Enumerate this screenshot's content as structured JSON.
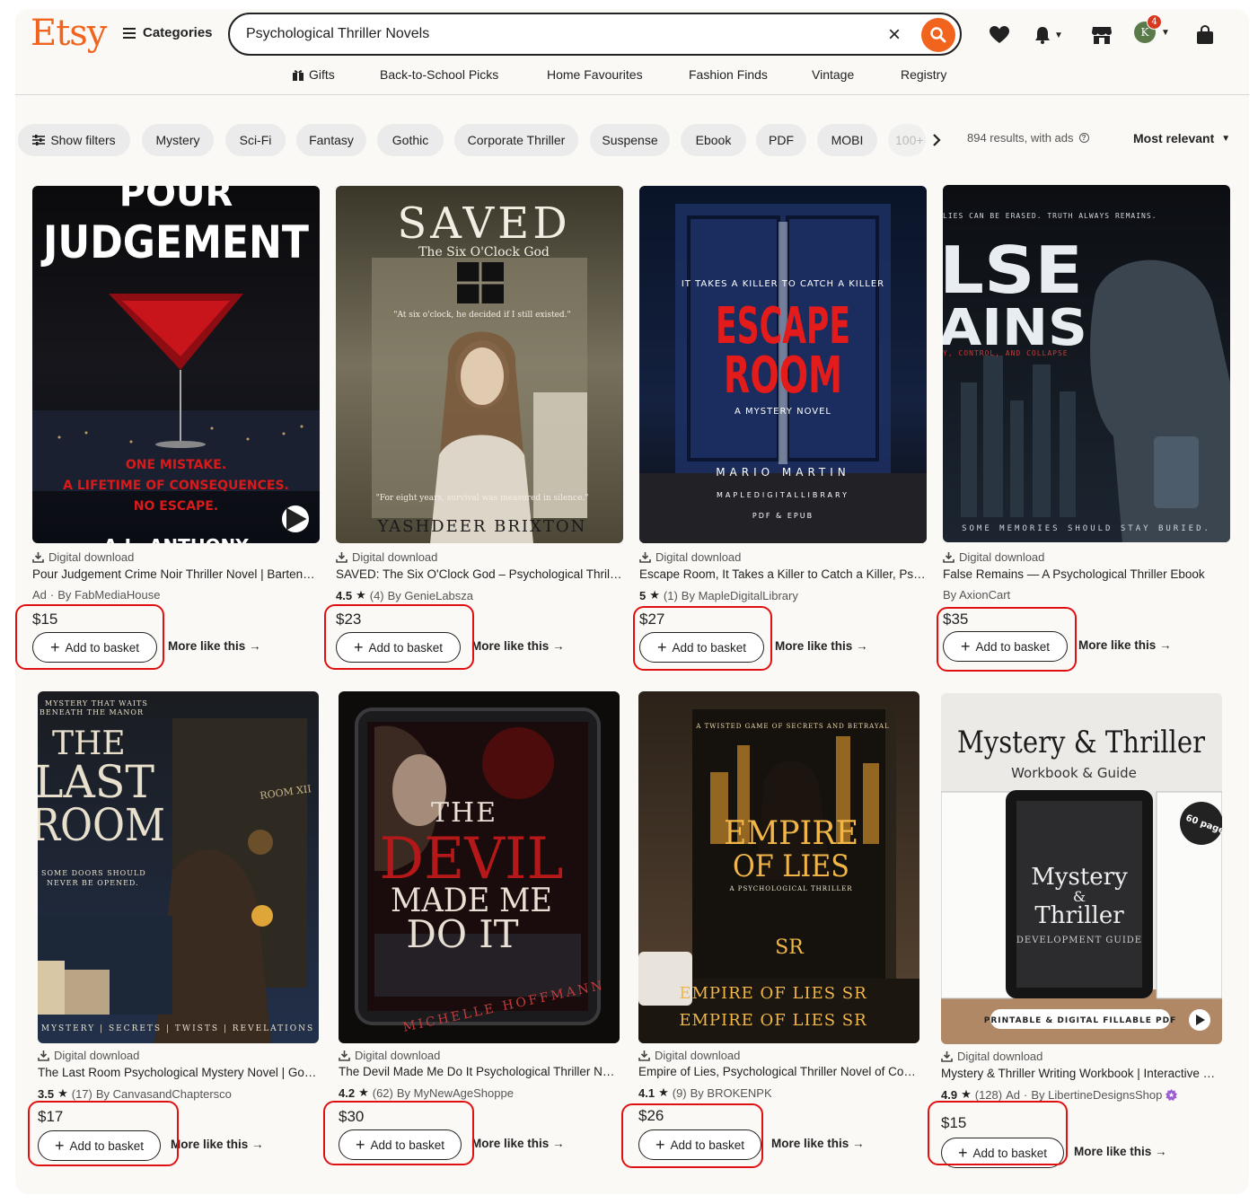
{
  "header": {
    "logo": "Etsy",
    "categories_label": "Categories",
    "search_value": "Psychological Thriller Novels",
    "notifications_count": "4",
    "avatar_letter": "K"
  },
  "nav": [
    "Gifts",
    "Back-to-School Picks",
    "Home Favourites",
    "Fashion Finds",
    "Vintage",
    "Registry"
  ],
  "filters": {
    "show_filters": "Show filters",
    "chips": [
      "Mystery",
      "Sci-Fi",
      "Fantasy",
      "Gothic",
      "Corporate Thriller",
      "Suspense",
      "Ebook",
      "PDF",
      "MOBI",
      "100+"
    ],
    "results": "894 results, with ads",
    "sort": "Most relevant"
  },
  "common": {
    "digital_download": "Digital download",
    "add_to_basket": "Add to basket",
    "more_like_this": "More like this →"
  },
  "listings": [
    {
      "title": "Pour Judgement Crime Noir Thriller Novel | Bartender Thriller",
      "rating": "",
      "reviews": "",
      "ad": "Ad",
      "shop": "By FabMediaHouse",
      "price": "$15",
      "cover_top": "POUR",
      "cover_main": "JUDGEMENT",
      "cover_tag": "ONE MISTAKE. A LIFETIME OF CONSEQUENCES. NO ESCAPE.",
      "cover_author": "A.L. ANTHONY"
    },
    {
      "title": "SAVED: The Six O'Clock God – Psychological Thriller Ebook",
      "rating": "4.5",
      "reviews": "(4)",
      "ad": "",
      "shop": "By GenieLabsza",
      "price": "$23",
      "cover_main": "SAVED",
      "cover_sub": "The Six O'Clock God",
      "cover_quote": "\"At six o'clock, he decided if I still existed.\"",
      "cover_quote2": "\"For eight years, survival was measured in silence.\"",
      "cover_author": "YASHDEER BRIXTON"
    },
    {
      "title": "Escape Room, It Takes a Killer to Catch a Killer, Psychological Thriller",
      "rating": "5",
      "reviews": "(1)",
      "ad": "",
      "shop": "By MapleDigitalLibrary",
      "price": "$27",
      "cover_top": "IT TAKES A KILLER TO CATCH A KILLER",
      "cover_main1": "ESCAPE",
      "cover_main2": "ROOM",
      "cover_sub": "A MYSTERY NOVEL",
      "cover_author": "MARIO MARTIN",
      "cover_pub": "MAPLEDIGITALLIBRARY",
      "cover_fmt": "PDF & EPUB"
    },
    {
      "title": "False Remains — A Psychological Thriller Ebook",
      "rating": "",
      "reviews": "",
      "ad": "",
      "shop": "By AxionCart",
      "price": "$35",
      "cover_top": "LIES CAN BE ERASED. TRUTH ALWAYS REMAINS.",
      "cover_main1": "LSE",
      "cover_main2": "AINS",
      "cover_sub": "Y, CONTROL, AND COLLAPSE",
      "cover_bottom": "SOME MEMORIES SHOULD STAY BURIED."
    },
    {
      "title": "The Last Room Psychological Mystery Novel | Gothic Thriller",
      "rating": "3.5",
      "reviews": "(17)",
      "ad": "",
      "shop": "By CanvasandChaptersco",
      "price": "$17",
      "cover_top": "MYSTERY THAT WAITS BENEATH THE MANOR",
      "cover_main1": "THE",
      "cover_main2": "LAST",
      "cover_main3": "ROOM",
      "cover_sub": "SOME DOORS SHOULD NEVER BE OPENED.",
      "cover_door": "ROOM XII",
      "cover_bottom": "MYSTERY | SECRETS | TWISTS | REVELATIONS"
    },
    {
      "title": "The Devil Made Me Do It Psychological Thriller Novel Ebook",
      "rating": "4.2",
      "reviews": "(62)",
      "ad": "",
      "shop": "By MyNewAgeShoppe",
      "price": "$30",
      "cover_main1": "THE",
      "cover_main2": "DEVIL",
      "cover_main3": "MADE ME",
      "cover_main4": "DO IT",
      "cover_author": "MICHELLE HOFFMANN"
    },
    {
      "title": "Empire of Lies, Psychological Thriller Novel of Corporate Secrets",
      "rating": "4.1",
      "reviews": "(9)",
      "ad": "",
      "shop": "By BROKENPK",
      "price": "$26",
      "cover_top": "A TWISTED GAME OF SECRETS AND BETRAYAL",
      "cover_main1": "EMPIRE",
      "cover_main2": "OF LIES",
      "cover_sub": "A PSYCHOLOGICAL THRILLER",
      "cover_author": "SR",
      "cover_spine": "EMPIRE OF LIES   SR"
    },
    {
      "title": "Mystery & Thriller Writing Workbook | Interactive Story Planner",
      "rating": "4.9",
      "reviews": "(128)",
      "ad": "Ad",
      "shop": "By LibertineDesignsShop",
      "price": "$15",
      "cover_main": "Mystery & Thriller",
      "cover_sub": "Workbook & Guide",
      "cover_tab1": "Mystery",
      "cover_tab2": "&",
      "cover_tab3": "Thriller",
      "cover_tab4": "DEVELOPMENT GUIDE",
      "cover_banner": "PRINTABLE & DIGITAL FILLABLE PDF",
      "cover_pages": "60 pages"
    }
  ],
  "colors": {
    "brand": "#f1641e",
    "highlight": "#e01010"
  }
}
